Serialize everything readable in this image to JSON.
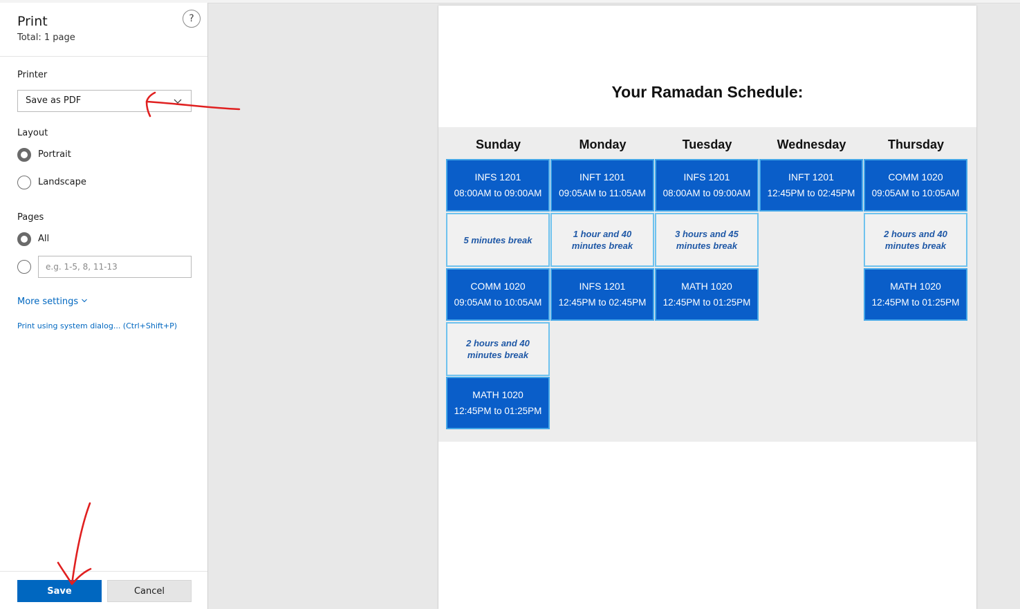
{
  "dialog": {
    "title": "Print",
    "total": "Total: 1 page",
    "help_symbol": "?"
  },
  "printer": {
    "label": "Printer",
    "selected": "Save as PDF"
  },
  "layout": {
    "label": "Layout",
    "options": [
      "Portrait",
      "Landscape"
    ],
    "selected": "Portrait"
  },
  "pages": {
    "label": "Pages",
    "all_label": "All",
    "range_placeholder": "e.g. 1-5, 8, 11-13",
    "selected": "All"
  },
  "links": {
    "more_settings": "More settings",
    "system_dialog": "Print using system dialog... (Ctrl+Shift+P)"
  },
  "buttons": {
    "save": "Save",
    "cancel": "Cancel"
  },
  "colors": {
    "accent": "#0067c0",
    "class_block": "#0a5ec9",
    "class_border": "#44a7e8",
    "break_text": "#1f58a6",
    "annotation": "#e02020"
  },
  "preview": {
    "title": "Your Ramadan Schedule:",
    "days": [
      {
        "name": "Sunday",
        "blocks": [
          {
            "kind": "class",
            "code": "INFS 1201",
            "time": "08:00AM to 09:00AM"
          },
          {
            "kind": "break",
            "text": "5 minutes break"
          },
          {
            "kind": "class",
            "code": "COMM 1020",
            "time": "09:05AM to 10:05AM"
          },
          {
            "kind": "break",
            "text": "2 hours and 40 minutes break"
          },
          {
            "kind": "class",
            "code": "MATH 1020",
            "time": "12:45PM to 01:25PM"
          }
        ]
      },
      {
        "name": "Monday",
        "blocks": [
          {
            "kind": "class",
            "code": "INFT 1201",
            "time": "09:05AM to 11:05AM"
          },
          {
            "kind": "break",
            "text": "1 hour and 40 minutes break"
          },
          {
            "kind": "class",
            "code": "INFS 1201",
            "time": "12:45PM to 02:45PM"
          }
        ]
      },
      {
        "name": "Tuesday",
        "blocks": [
          {
            "kind": "class",
            "code": "INFS 1201",
            "time": "08:00AM to 09:00AM"
          },
          {
            "kind": "break",
            "text": "3 hours and 45 minutes break"
          },
          {
            "kind": "class",
            "code": "MATH 1020",
            "time": "12:45PM to 01:25PM"
          }
        ]
      },
      {
        "name": "Wednesday",
        "blocks": [
          {
            "kind": "class",
            "code": "INFT 1201",
            "time": "12:45PM to 02:45PM"
          }
        ]
      },
      {
        "name": "Thursday",
        "blocks": [
          {
            "kind": "class",
            "code": "COMM 1020",
            "time": "09:05AM to 10:05AM"
          },
          {
            "kind": "break",
            "text": "2 hours and 40 minutes break"
          },
          {
            "kind": "class",
            "code": "MATH 1020",
            "time": "12:45PM to 01:25PM"
          }
        ]
      }
    ]
  }
}
